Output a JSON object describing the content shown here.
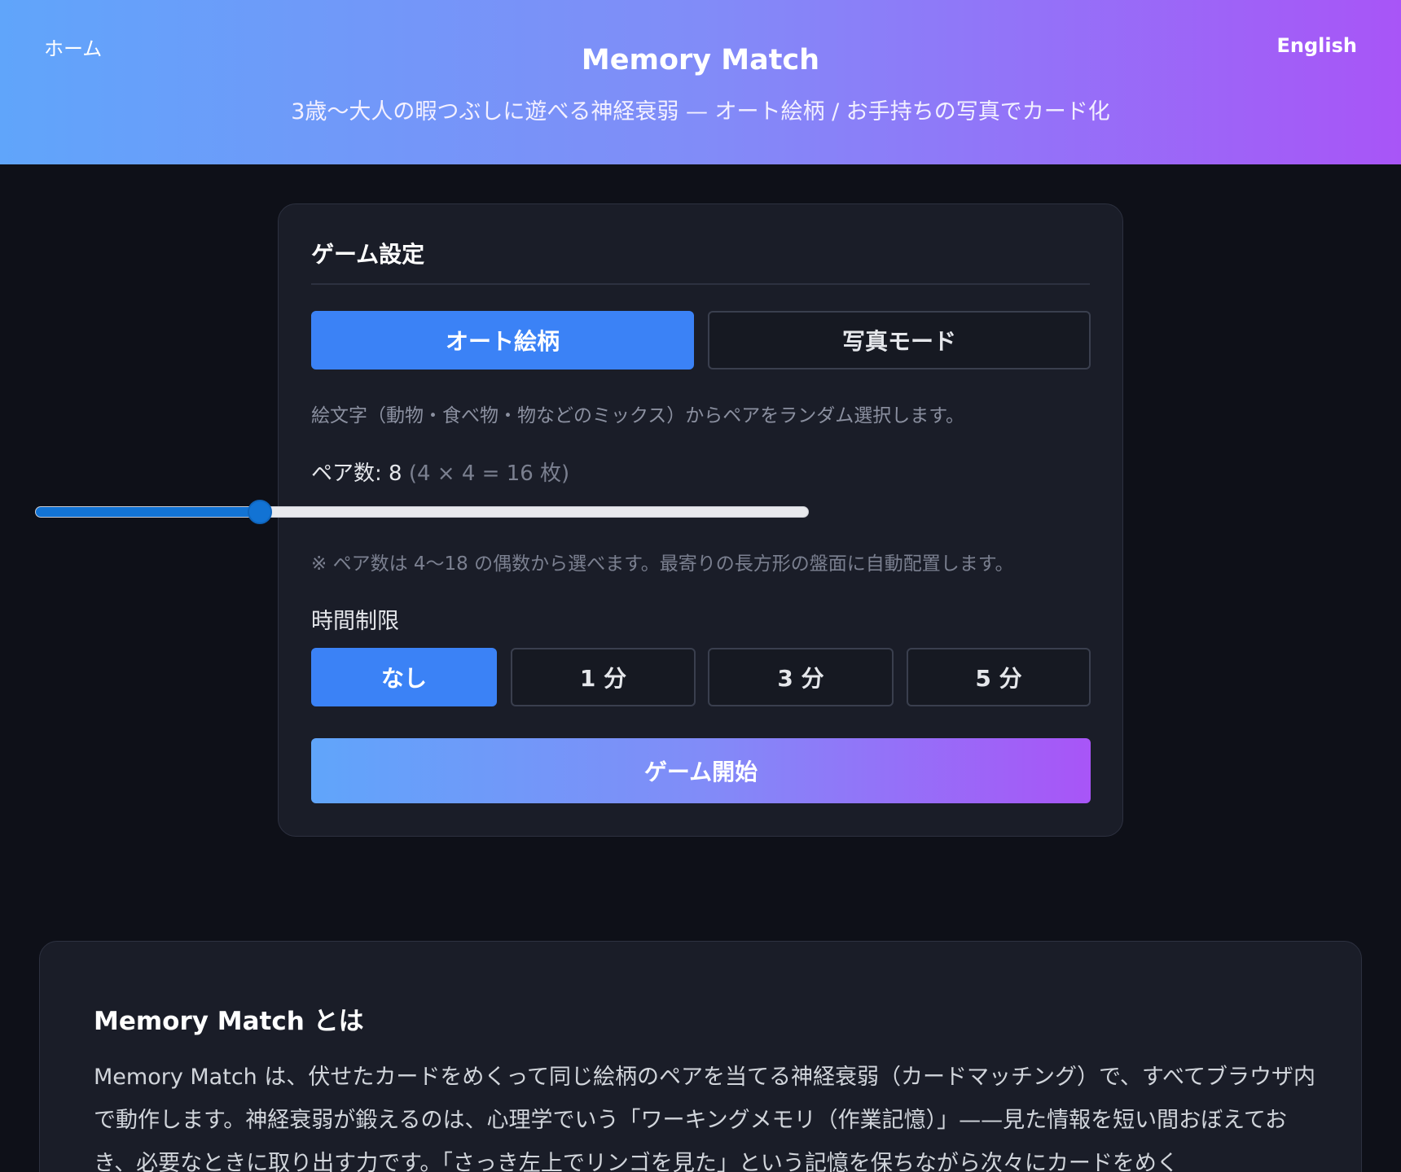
{
  "nav": {
    "home_label": "ホーム",
    "language_label": "English"
  },
  "header": {
    "title": "Memory Match",
    "subtitle": "3歳〜大人の暇つぶしに遊べる神経衰弱 — オート絵柄 / お手持ちの写真でカード化"
  },
  "settings": {
    "title": "ゲーム設定",
    "modes": [
      {
        "label": "オート絵柄",
        "active": true
      },
      {
        "label": "写真モード",
        "active": false
      }
    ],
    "mode_description": "絵文字（動物・食べ物・物などのミックス）からペアをランダム選択します。",
    "pairs": {
      "label": "ペア数: ",
      "value": "8",
      "detail": "(4 × 4 = 16 枚)",
      "slider_fraction": 0.29
    },
    "pairs_note": "※ ペア数は 4〜18 の偶数から選べます。最寄りの長方形の盤面に自動配置します。",
    "time_limit": {
      "label": "時間制限",
      "options": [
        {
          "label": "なし",
          "active": true
        },
        {
          "label": "1 分",
          "active": false
        },
        {
          "label": "3 分",
          "active": false
        },
        {
          "label": "5 分",
          "active": false
        }
      ]
    },
    "start_label": "ゲーム開始"
  },
  "about": {
    "title": "Memory Match とは",
    "body": "Memory Match は、伏せたカードをめくって同じ絵柄のペアを当てる神経衰弱（カードマッチング）で、すべてブラウザ内で動作します。神経衰弱が鍛えるのは、心理学でいう「ワーキングメモリ（作業記憶）」——見た情報を短い間おぼえておき、必要なときに取り出す力です。「さっき左上でリンゴを見た」という記憶を保ちながら次々にカードをめく"
  },
  "colors": {
    "accent": "#3b82f6",
    "gradient_start": "#60a5fa",
    "gradient_end": "#a855f7",
    "background": "#0e1018",
    "card": "#1a1d28"
  }
}
